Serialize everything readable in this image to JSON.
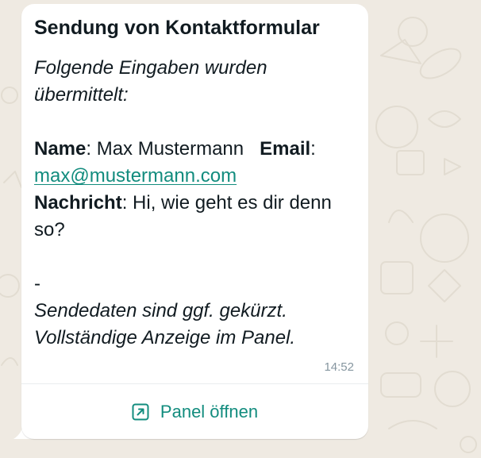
{
  "message": {
    "title": "Sendung von Kontaktformular",
    "intro": "Folgende Eingaben wurden übermittelt:",
    "name_label": "Name",
    "name_value": "Max Mustermann",
    "email_label": "Email",
    "email_value": "max@mustermann.com",
    "message_label": "Nachricht",
    "message_value": "Hi, wie geht es dir denn so?",
    "separator": "-",
    "note": "Sendedaten sind ggf. gekürzt. Vollständige Anzeige im Panel.",
    "time": "14:52"
  },
  "action": {
    "label": "Panel öffnen",
    "icon": "external-link-icon"
  },
  "colors": {
    "background": "#efeae2",
    "bubble": "#ffffff",
    "accent": "#128c7e",
    "text": "#111b21",
    "meta": "#8696a0"
  }
}
